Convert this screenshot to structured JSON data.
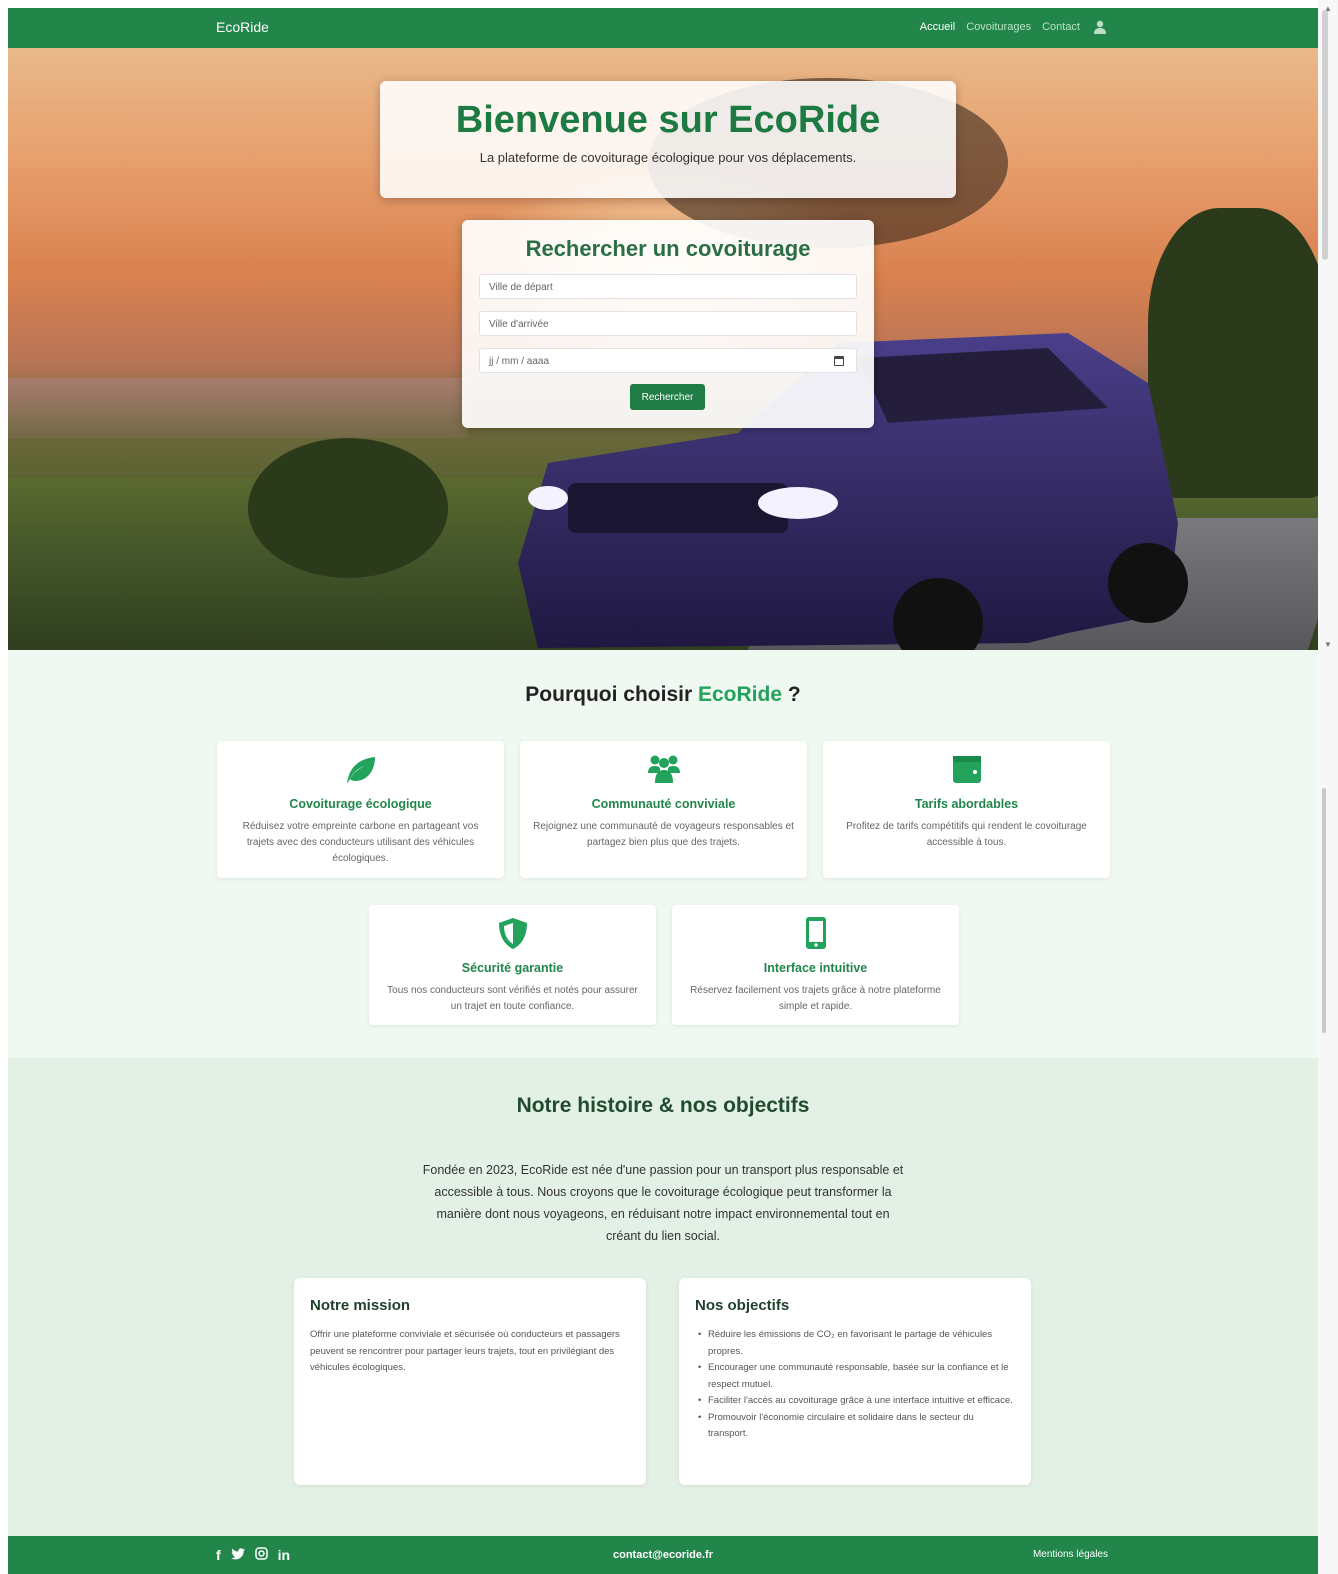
{
  "nav": {
    "brand": "EcoRide",
    "links": [
      "Accueil",
      "Covoiturages",
      "Contact"
    ],
    "active_link": "Accueil",
    "user_icon": "user-icon"
  },
  "hero": {
    "title": "Bienvenue sur EcoRide",
    "subtitle": "La plateforme de covoiturage écologique pour vos déplacements.",
    "search": {
      "title": "Rechercher un covoiturage",
      "departure_placeholder": "Ville de départ",
      "arrival_placeholder": "Ville d'arrivée",
      "date_placeholder": "jj / mm / aaaa",
      "button_label": "Rechercher"
    }
  },
  "why": {
    "title_prefix": "Pourquoi choisir",
    "title_accent": "EcoRide",
    "title_suffix": "?",
    "features": [
      {
        "icon": "leaf-icon",
        "title": "Covoiturage écologique",
        "desc": "Réduisez votre empreinte carbone en partageant vos trajets avec des conducteurs utilisant des véhicules écologiques."
      },
      {
        "icon": "users-icon",
        "title": "Communauté conviviale",
        "desc": "Rejoignez une communauté de voyageurs responsables et partagez bien plus que des trajets."
      },
      {
        "icon": "wallet-icon",
        "title": "Tarifs abordables",
        "desc": "Profitez de tarifs compétitifs qui rendent le covoiturage accessible à tous."
      },
      {
        "icon": "shield-icon",
        "title": "Sécurité garantie",
        "desc": "Tous nos conducteurs sont vérifiés et notés pour assurer un trajet en toute confiance."
      },
      {
        "icon": "mobile-icon",
        "title": "Interface intuitive",
        "desc": "Réservez facilement vos trajets grâce à notre plateforme simple et rapide."
      }
    ]
  },
  "story": {
    "title": "Notre histoire & nos objectifs",
    "text": "Fondée en 2023, EcoRide est née d'une passion pour un transport plus responsable et accessible à tous. Nous croyons que le covoiturage écologique peut transformer la manière dont nous voyageons, en réduisant notre impact environnemental tout en créant du lien social.",
    "mission": {
      "title": "Notre mission",
      "text": "Offrir une plateforme conviviale et sécurisée où conducteurs et passagers peuvent se rencontrer pour partager leurs trajets, tout en privilégiant des véhicules écologiques."
    },
    "goals": {
      "title": "Nos objectifs",
      "items": [
        "Réduire les émissions de CO₂ en favorisant le partage de véhicules propres.",
        "Encourager une communauté responsable, basée sur la confiance et le respect mutuel.",
        "Faciliter l'accès au covoiturage grâce à une interface intuitive et efficace.",
        "Promouvoir l'économie circulaire et solidaire dans le secteur du transport."
      ]
    }
  },
  "footer": {
    "social_icons": [
      "facebook-icon",
      "twitter-icon",
      "instagram-icon",
      "linkedin-icon"
    ],
    "email": "contact@ecoride.fr",
    "legal": "Mentions légales"
  },
  "colors": {
    "brand_green": "#22864a",
    "accent_green": "#22a25a",
    "page_bg": "#f0f8f2"
  }
}
